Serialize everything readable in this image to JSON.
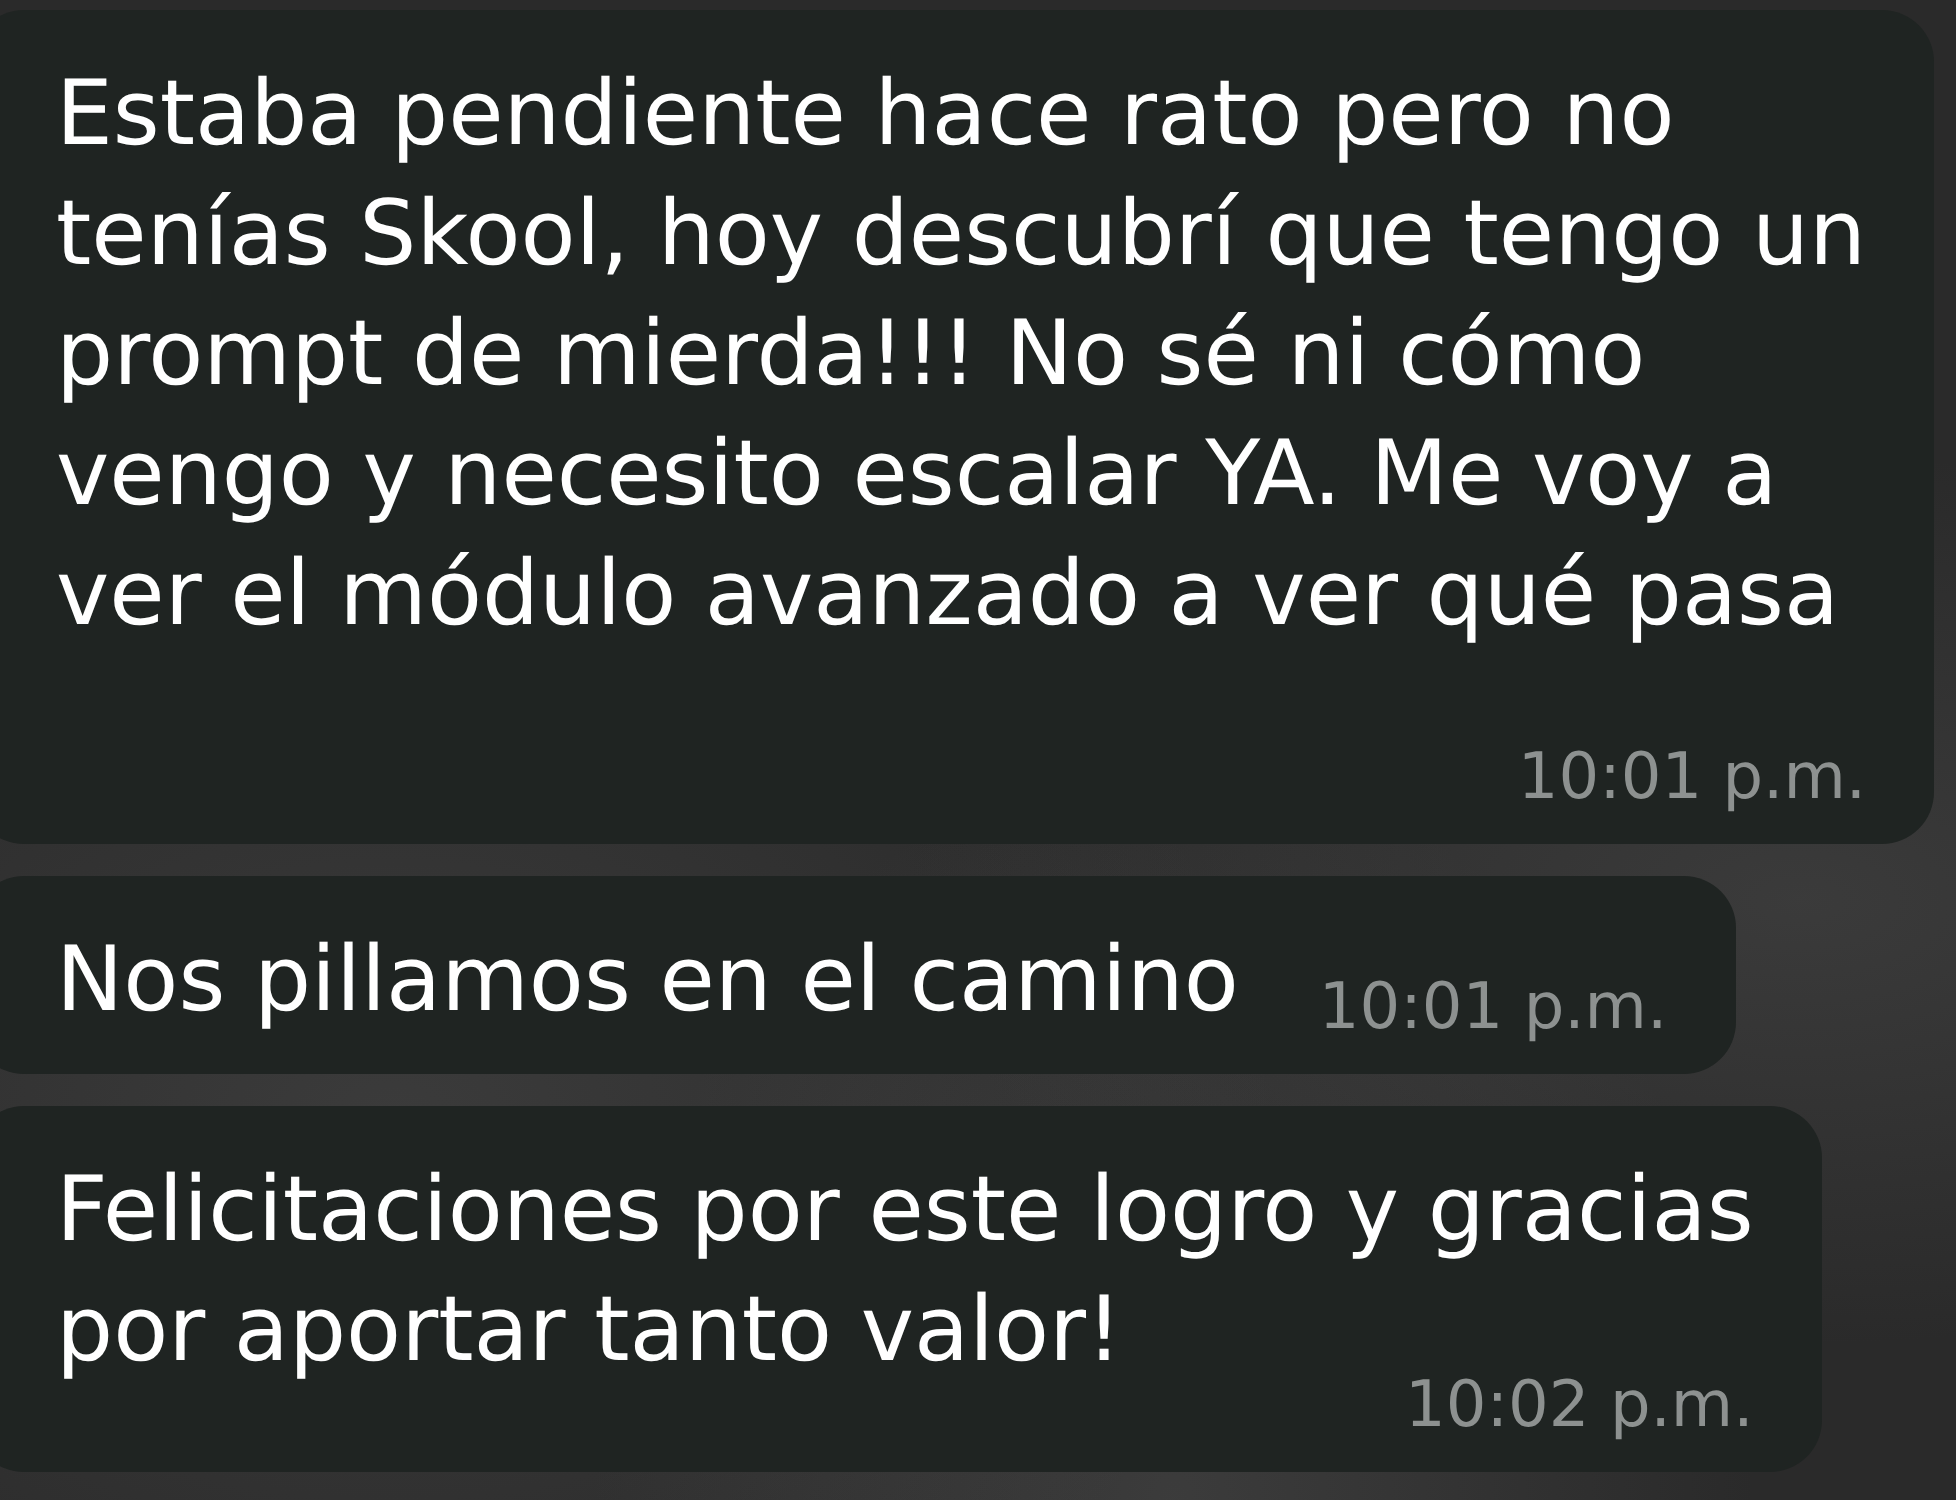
{
  "messages": [
    {
      "text": "Estaba pendiente hace rato pero no\ntenías Skool, hoy descubrí que tengo un\nprompt de mierda!!! No sé ni cómo\nvengo y necesito escalar YA. Me voy a\nver el módulo avanzado a ver qué pasa",
      "time": "10:01 p.m."
    },
    {
      "text": "Nos pillamos en el camino",
      "time": "10:01 p.m."
    },
    {
      "text": "Felicitaciones por este logro y gracias\npor aportar tanto valor!",
      "time": "10:02 p.m."
    }
  ]
}
